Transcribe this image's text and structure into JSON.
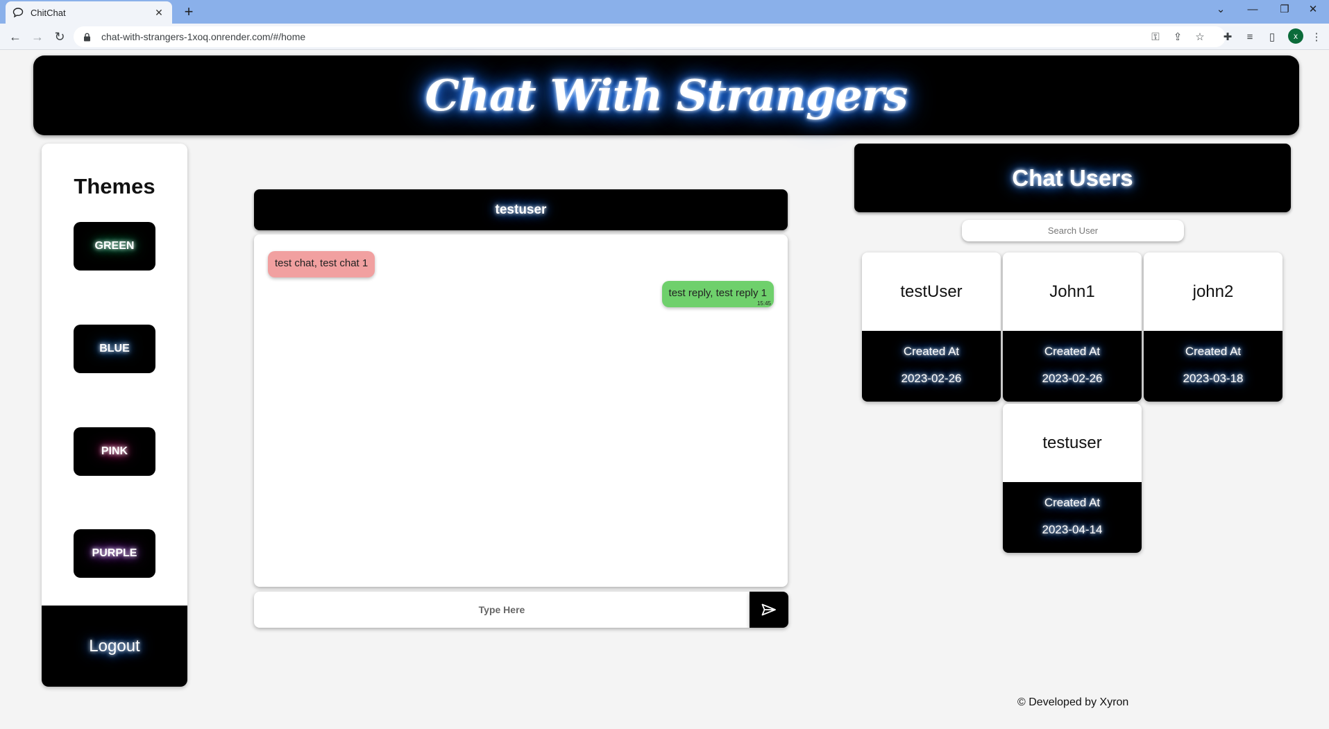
{
  "browser": {
    "tab_title": "ChitChat",
    "url": "chat-with-strangers-1xoq.onrender.com/#/home",
    "profile_initial": "x"
  },
  "header": {
    "title": "Chat With Strangers"
  },
  "themes": {
    "title": "Themes",
    "buttons": [
      {
        "label": "GREEN",
        "glow": "#1fbf7a"
      },
      {
        "label": "BLUE",
        "glow": "#2f8cff"
      },
      {
        "label": "PINK",
        "glow": "#ff3d9a"
      },
      {
        "label": "PURPLE",
        "glow": "#b44dff"
      }
    ],
    "logout_label": "Logout"
  },
  "chat": {
    "username": "testuser",
    "messages": [
      {
        "text": "test chat, test chat 1",
        "direction": "incoming",
        "color": "#f1a0a0"
      },
      {
        "text": "test reply, test reply 1",
        "direction": "outgoing",
        "time": "15:45",
        "color": "#6fd06c"
      }
    ],
    "input_placeholder": "Type Here"
  },
  "users": {
    "title": "Chat Users",
    "search_placeholder": "Search User",
    "list": [
      {
        "name": "testUser",
        "created_label": "Created At",
        "created_at": "2023-02-26"
      },
      {
        "name": "John1",
        "created_label": "Created At",
        "created_at": "2023-02-26"
      },
      {
        "name": "john2",
        "created_label": "Created At",
        "created_at": "2023-03-18"
      },
      {
        "name": "testuser",
        "created_label": "Created At",
        "created_at": "2023-04-14"
      }
    ]
  },
  "footer": {
    "text": "© Developed by Xyron"
  },
  "colors": {
    "accent_glow": "#2f8cff",
    "panel": "#000000",
    "page_bg": "#f4f4f4"
  }
}
